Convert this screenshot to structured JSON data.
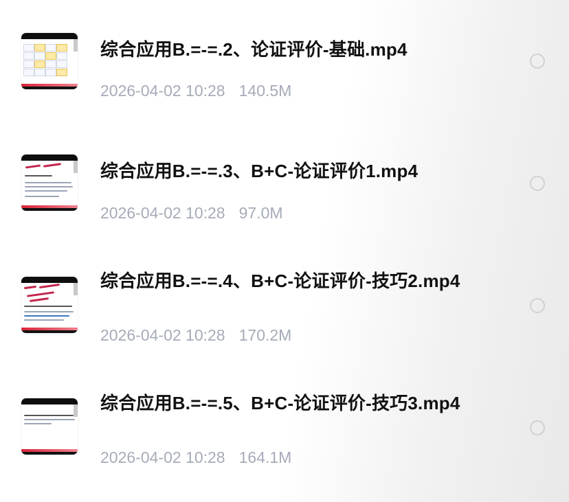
{
  "files": [
    {
      "name": "综合应用B.=-=.2、论证评价-基础.mp4",
      "date": "2026-04-02 10:28",
      "size": "140.5M",
      "thumbnail": "video-thumbnail-table",
      "selected": false
    },
    {
      "name": "综合应用B.=-=.3、B+C-论证评价1.mp4",
      "date": "2026-04-02 10:28",
      "size": "97.0M",
      "thumbnail": "video-thumbnail-handwriting",
      "selected": false
    },
    {
      "name": "综合应用B.=-=.4、B+C-论证评价-技巧2.mp4",
      "date": "2026-04-02 10:28",
      "size": "170.2M",
      "thumbnail": "video-thumbnail-annotated",
      "selected": false
    },
    {
      "name": "综合应用B.=-=.5、B+C-论证评价-技巧3.mp4",
      "date": "2026-04-02 10:28",
      "size": "164.1M",
      "thumbnail": "video-thumbnail-text",
      "selected": false
    }
  ],
  "colors": {
    "title": "#111111",
    "meta": "#a5abb8",
    "radio_border": "#cfd1d6",
    "progress": "#d9243a"
  }
}
